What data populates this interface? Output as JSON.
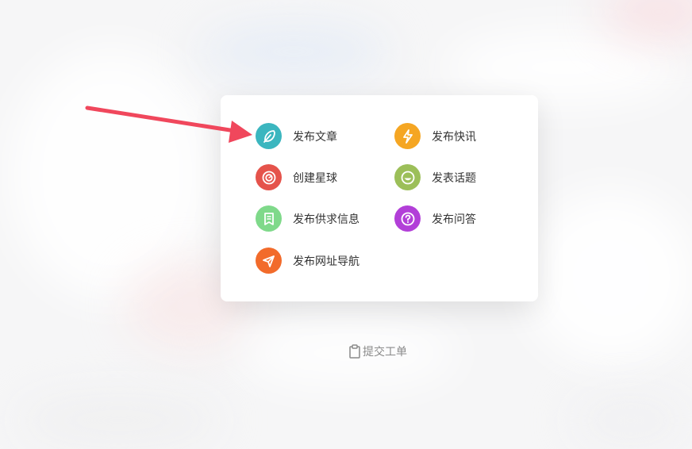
{
  "menu": {
    "items": [
      {
        "label": "发布文章",
        "icon": "feather-icon",
        "color": "#3bb6bf"
      },
      {
        "label": "发布快讯",
        "icon": "lightning-icon",
        "color": "#f5a623"
      },
      {
        "label": "创建星球",
        "icon": "planet-icon",
        "color": "#e5534b"
      },
      {
        "label": "发表话题",
        "icon": "smile-icon",
        "color": "#9cbf59"
      },
      {
        "label": "发布供求信息",
        "icon": "document-icon",
        "color": "#7fd98a"
      },
      {
        "label": "发布问答",
        "icon": "question-icon",
        "color": "#b23fd8"
      },
      {
        "label": "发布网址导航",
        "icon": "send-icon",
        "color": "#f26b2b"
      }
    ]
  },
  "footer": {
    "ticket_label": "提交工单",
    "ticket_icon": "clipboard-icon"
  },
  "annotation": {
    "arrow_color": "#f0475c"
  }
}
